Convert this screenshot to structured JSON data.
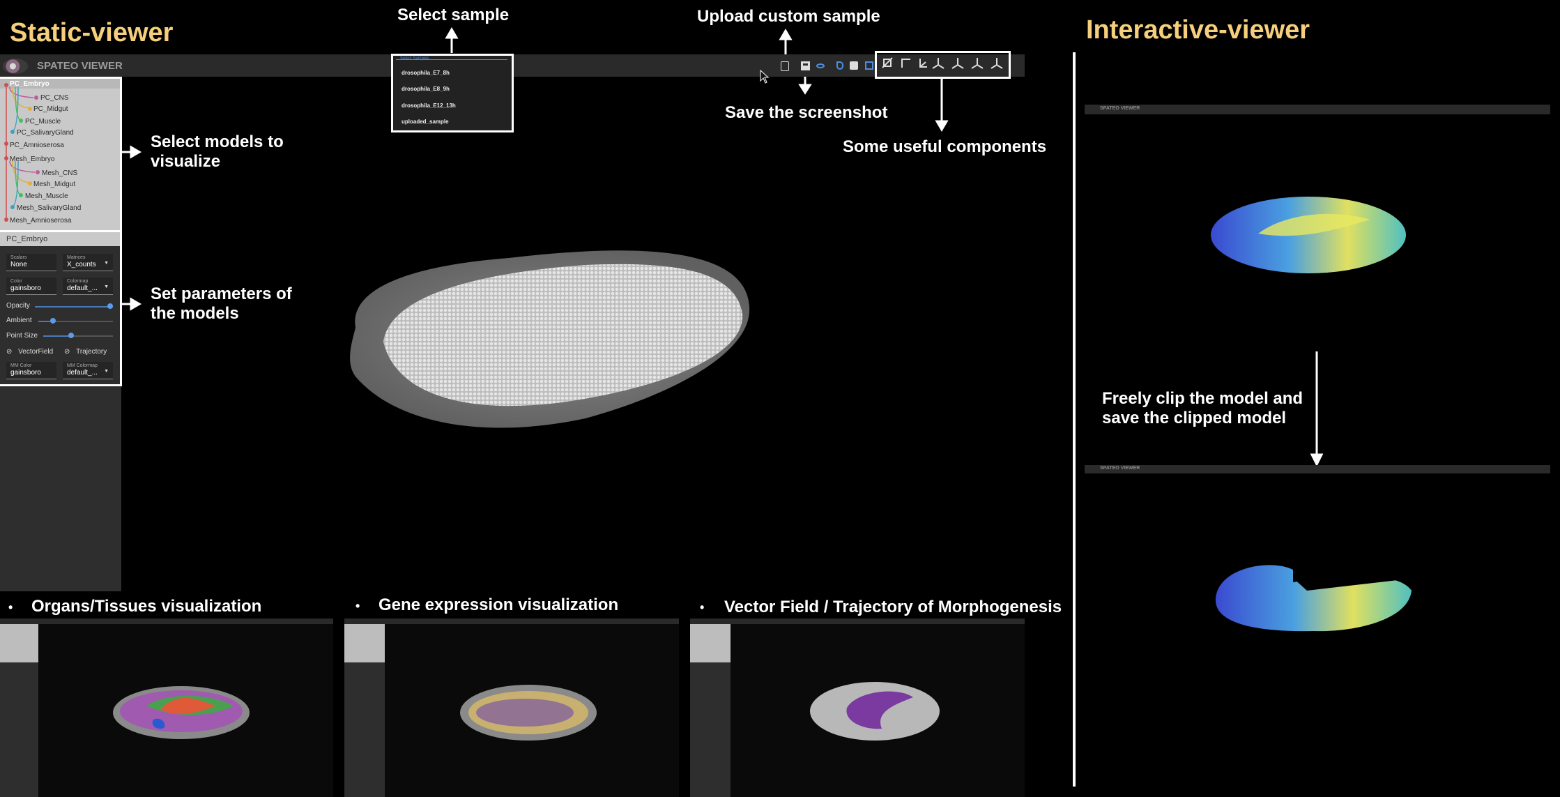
{
  "titles": {
    "static": "Static-viewer",
    "interactive": "Interactive-viewer"
  },
  "annotations": {
    "select_sample": "Select sample",
    "upload": "Upload custom sample",
    "screenshot": "Save the screenshot",
    "components": "Some useful components",
    "select_models": "Select models to visualize",
    "set_params": "Set parameters of the models",
    "clip": "Freely clip the model and save the clipped model"
  },
  "app": {
    "name": "SPATEO VIEWER"
  },
  "tree": {
    "items": [
      "PC_Embryo",
      "PC_CNS",
      "PC_Midgut",
      "PC_Muscle",
      "PC_SalivaryGland",
      "PC_Amnioserosa",
      "Mesh_Embryo",
      "Mesh_CNS",
      "Mesh_Midgut",
      "Mesh_Muscle",
      "Mesh_SalivaryGland",
      "Mesh_Amnioserosa"
    ]
  },
  "params": {
    "header": "PC_Embryo",
    "scalars_label": "Scalars",
    "scalars_value": "None",
    "matrices_label": "Matrices",
    "matrices_value": "X_counts",
    "color_label": "Color",
    "color_value": "gainsboro",
    "colormap_label": "Colormap",
    "colormap_value": "default_...",
    "opacity": "Opacity",
    "ambient": "Ambient",
    "point_size": "Point Size",
    "opacity_level": 1.0,
    "ambient_level": 0.2,
    "point_size_level": 0.4,
    "vectorfield": "VectorField",
    "trajectory": "Trajectory",
    "mm_color_label": "MM Color",
    "mm_color_value": "gainsboro",
    "mm_colormap_label": "MM Colormap",
    "mm_colormap_value": "default_..."
  },
  "sample_dropdown": {
    "header": "Select Samples",
    "options": [
      "drosophila_E7_8h",
      "drosophila_E8_9h",
      "drosophila_E12_13h",
      "uploaded_sample"
    ]
  },
  "bullets": {
    "b1": "Organs/Tissues visualization",
    "b2": "Gene expression visualization",
    "b3": "Vector Field / Trajectory of Morphogenesis model"
  },
  "colors": {
    "accent": "#f6cf7d",
    "toolbar": "#2a2a2a",
    "sidebar": "#2e2e2e",
    "blue": "#4a8fe0"
  },
  "icons": [
    "file-icon",
    "save-icon",
    "eye-icon",
    "brush-icon",
    "cube-icon",
    "layers-icon",
    "hide-icon",
    "crop-icon",
    "axes-icon",
    "view-x-icon",
    "view-y-icon",
    "view-z-icon",
    "view-iso-icon"
  ]
}
